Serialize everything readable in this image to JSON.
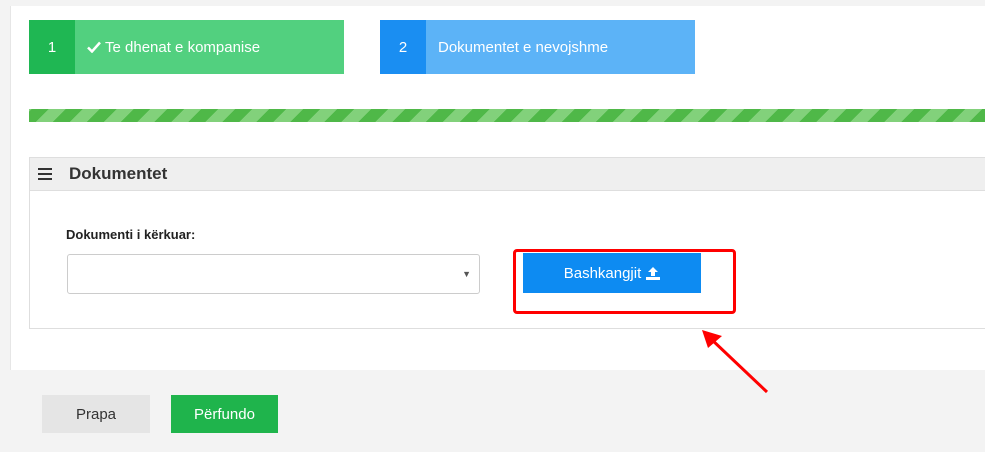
{
  "steps": [
    {
      "number": "1",
      "label": "Te dhenat e kompanise",
      "status": "completed",
      "color": "#52d07f"
    },
    {
      "number": "2",
      "label": "Dokumentet e nevojshme",
      "status": "active",
      "color": "#5cb3f7"
    }
  ],
  "progress": {
    "fraction": 1.0
  },
  "panel": {
    "title": "Dokumentet",
    "field_label": "Dokumenti i kërkuar:",
    "select_value": "",
    "attach_button": "Bashkangjit"
  },
  "footer": {
    "back_label": "Prapa",
    "finish_label": "Përfundo"
  },
  "icons": [
    "check-icon",
    "menu-icon",
    "dropdown-arrow-icon",
    "upload-icon"
  ],
  "colors": {
    "accent_blue": "#0d8bf2",
    "success_green": "#1fb44c",
    "annotation_red": "#ff0000"
  }
}
